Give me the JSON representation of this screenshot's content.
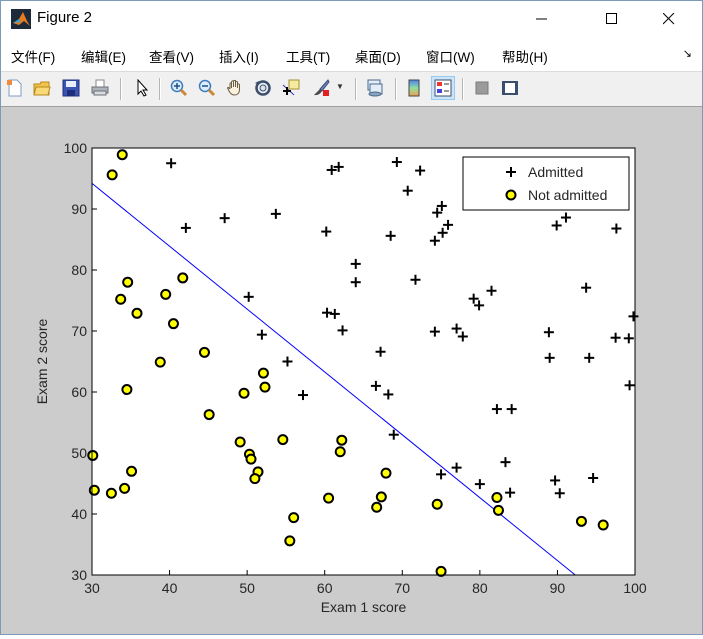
{
  "window": {
    "title": "Figure 2",
    "minimize_icon": "minimize-icon",
    "maximize_icon": "maximize-icon",
    "close_icon": "close-icon"
  },
  "menu": {
    "items": [
      "文件(F)",
      "编辑(E)",
      "查看(V)",
      "插入(I)",
      "工具(T)",
      "桌面(D)",
      "窗口(W)",
      "帮助(H)"
    ],
    "overflow_icon": "dock-arrow-icon"
  },
  "toolbar": {
    "buttons": [
      {
        "name": "new-figure",
        "icon": "new-file-icon"
      },
      {
        "name": "open-file",
        "icon": "folder-open-icon"
      },
      {
        "name": "save-figure",
        "icon": "save-icon"
      },
      {
        "name": "print-figure",
        "icon": "print-icon"
      },
      {
        "name": "edit-plot",
        "icon": "pointer-arrow-icon"
      },
      {
        "name": "zoom-in",
        "icon": "zoom-in-icon"
      },
      {
        "name": "zoom-out",
        "icon": "zoom-out-icon"
      },
      {
        "name": "pan",
        "icon": "hand-pan-icon"
      },
      {
        "name": "rotate-3d",
        "icon": "rotate-3d-icon"
      },
      {
        "name": "data-cursor",
        "icon": "data-cursor-icon"
      },
      {
        "name": "brush",
        "icon": "brush-icon"
      },
      {
        "name": "link-plot",
        "icon": "link-plot-icon"
      },
      {
        "name": "insert-colorbar",
        "icon": "colorbar-icon"
      },
      {
        "name": "insert-legend",
        "icon": "legend-icon",
        "active": true
      },
      {
        "name": "hide-plot-tools",
        "icon": "hide-plot-tools-icon"
      },
      {
        "name": "show-plot-tools",
        "icon": "show-plot-tools-icon"
      }
    ]
  },
  "chart_data": {
    "type": "scatter",
    "title": "",
    "xlabel": "Exam 1 score",
    "ylabel": "Exam 2 score",
    "xlim": [
      30,
      100
    ],
    "ylim": [
      30,
      100
    ],
    "xticks": [
      30,
      40,
      50,
      60,
      70,
      80,
      90,
      100
    ],
    "yticks": [
      30,
      40,
      50,
      60,
      70,
      80,
      90,
      100
    ],
    "grid": false,
    "legend": {
      "placement": "top-right",
      "entries": [
        "Admitted",
        "Not admitted"
      ]
    },
    "colors": {
      "admitted_marker": "#000000",
      "not_admitted_fill": "#ffff00",
      "not_admitted_edge": "#000000",
      "boundary": "#0000ff"
    },
    "series": [
      {
        "name": "Admitted",
        "marker": "+",
        "points": [
          [
            40.2,
            97.5
          ],
          [
            42.1,
            86.9
          ],
          [
            47.1,
            88.5
          ],
          [
            53.7,
            89.2
          ],
          [
            50.2,
            75.6
          ],
          [
            51.9,
            69.4
          ],
          [
            55.2,
            65.0
          ],
          [
            57.2,
            59.5
          ],
          [
            60.2,
            86.3
          ],
          [
            60.3,
            73.0
          ],
          [
            60.9,
            96.4
          ],
          [
            61.3,
            72.8
          ],
          [
            61.8,
            96.9
          ],
          [
            62.3,
            70.1
          ],
          [
            64.0,
            81.0
          ],
          [
            64.0,
            78.0
          ],
          [
            66.6,
            61.0
          ],
          [
            67.2,
            66.6
          ],
          [
            68.2,
            59.6
          ],
          [
            69.3,
            97.7
          ],
          [
            70.7,
            93.0
          ],
          [
            72.3,
            96.3
          ],
          [
            71.7,
            78.4
          ],
          [
            68.5,
            85.6
          ],
          [
            74.2,
            84.8
          ],
          [
            74.5,
            89.4
          ],
          [
            75.1,
            90.5
          ],
          [
            75.2,
            86.1
          ],
          [
            75.9,
            87.4
          ],
          [
            74.2,
            69.9
          ],
          [
            75.0,
            46.5
          ],
          [
            77.0,
            70.4
          ],
          [
            77.8,
            69.1
          ],
          [
            77.0,
            47.6
          ],
          [
            79.2,
            75.3
          ],
          [
            79.9,
            74.2
          ],
          [
            81.5,
            76.6
          ],
          [
            80.0,
            44.9
          ],
          [
            82.2,
            57.2
          ],
          [
            83.3,
            48.5
          ],
          [
            84.1,
            57.2
          ],
          [
            88.9,
            69.8
          ],
          [
            89.0,
            65.6
          ],
          [
            89.9,
            87.3
          ],
          [
            89.7,
            45.5
          ],
          [
            90.3,
            43.4
          ],
          [
            91.1,
            88.6
          ],
          [
            93.7,
            77.1
          ],
          [
            94.1,
            65.6
          ],
          [
            94.6,
            45.9
          ],
          [
            97.6,
            86.8
          ],
          [
            97.5,
            68.9
          ],
          [
            99.2,
            68.8
          ],
          [
            99.3,
            61.1
          ],
          [
            99.8,
            72.4
          ],
          [
            68.9,
            53.0
          ],
          [
            83.9,
            43.5
          ]
        ]
      },
      {
        "name": "Not admitted",
        "marker": "o",
        "points": [
          [
            34.6,
            78.0
          ],
          [
            30.3,
            43.9
          ],
          [
            35.8,
            72.9
          ],
          [
            45.1,
            56.3
          ],
          [
            39.5,
            76.0
          ],
          [
            38.8,
            64.9
          ],
          [
            34.2,
            44.2
          ],
          [
            33.9,
            98.9
          ],
          [
            32.6,
            95.6
          ],
          [
            52.1,
            63.1
          ],
          [
            49.6,
            59.8
          ],
          [
            44.5,
            66.5
          ],
          [
            40.5,
            71.2
          ],
          [
            33.7,
            75.2
          ],
          [
            34.5,
            60.4
          ],
          [
            30.1,
            49.6
          ],
          [
            35.1,
            47.0
          ],
          [
            32.5,
            43.4
          ],
          [
            41.7,
            78.7
          ],
          [
            50.3,
            49.8
          ],
          [
            50.5,
            49.0
          ],
          [
            51.4,
            46.9
          ],
          [
            51.0,
            45.8
          ],
          [
            54.6,
            52.2
          ],
          [
            52.3,
            60.8
          ],
          [
            49.1,
            51.8
          ],
          [
            55.5,
            35.6
          ],
          [
            56.0,
            39.4
          ],
          [
            60.5,
            42.6
          ],
          [
            62.0,
            50.2
          ],
          [
            62.2,
            52.1
          ],
          [
            66.7,
            41.1
          ],
          [
            67.3,
            42.8
          ],
          [
            67.9,
            46.7
          ],
          [
            74.5,
            41.6
          ],
          [
            75.0,
            30.6
          ],
          [
            82.2,
            42.7
          ],
          [
            82.4,
            40.6
          ],
          [
            93.1,
            38.8
          ],
          [
            95.9,
            38.2
          ]
        ]
      }
    ],
    "decision_boundary": {
      "type": "line",
      "points": [
        [
          30,
          94.2
        ],
        [
          92.3,
          30
        ]
      ]
    }
  }
}
